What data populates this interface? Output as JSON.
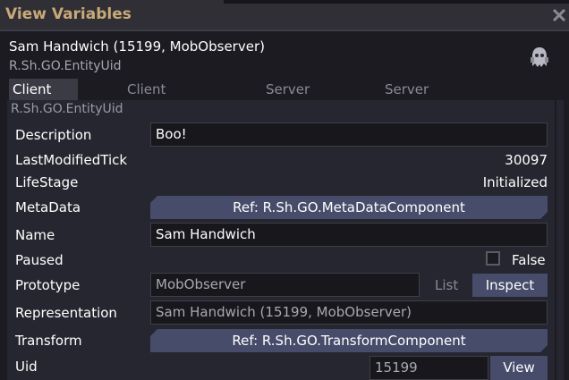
{
  "window": {
    "title": "View Variables",
    "close_icon": "close-icon"
  },
  "entity": {
    "name": "Sam Handwich (15199, MobObserver)",
    "type": "R.Sh.GO.EntityUid",
    "sprite_icon": "ghost-sprite-icon"
  },
  "tabs": [
    {
      "label": "Client Variables",
      "active": true
    },
    {
      "label": "Client Components",
      "active": false
    },
    {
      "label": "Server Variables",
      "active": false
    },
    {
      "label": "Server Components",
      "active": false
    }
  ],
  "path": "R.Sh.GO.EntityUid",
  "rows": {
    "description": {
      "label": "Description",
      "value": "Boo!"
    },
    "last_modified_tick": {
      "label": "LastModifiedTick",
      "value": "30097"
    },
    "life_stage": {
      "label": "LifeStage",
      "value": "Initialized"
    },
    "meta_data": {
      "label": "MetaData",
      "value": "Ref: R.Sh.GO.MetaDataComponent"
    },
    "name": {
      "label": "Name",
      "value": "Sam Handwich"
    },
    "paused": {
      "label": "Paused",
      "checked": false,
      "value_label": "False"
    },
    "prototype": {
      "label": "Prototype",
      "value": "MobObserver",
      "list_label": "List",
      "inspect_label": "Inspect"
    },
    "representation": {
      "label": "Representation",
      "value": "Sam Handwich (15199, MobObserver)"
    },
    "transform": {
      "label": "Transform",
      "value": "Ref: R.Sh.GO.TransformComponent"
    },
    "uid": {
      "label": "Uid",
      "value": "15199",
      "view_label": "View"
    }
  },
  "colors": {
    "title": "#c9a978",
    "button": "#464c6a",
    "field_bg": "#17171c",
    "panel": "#262630"
  }
}
